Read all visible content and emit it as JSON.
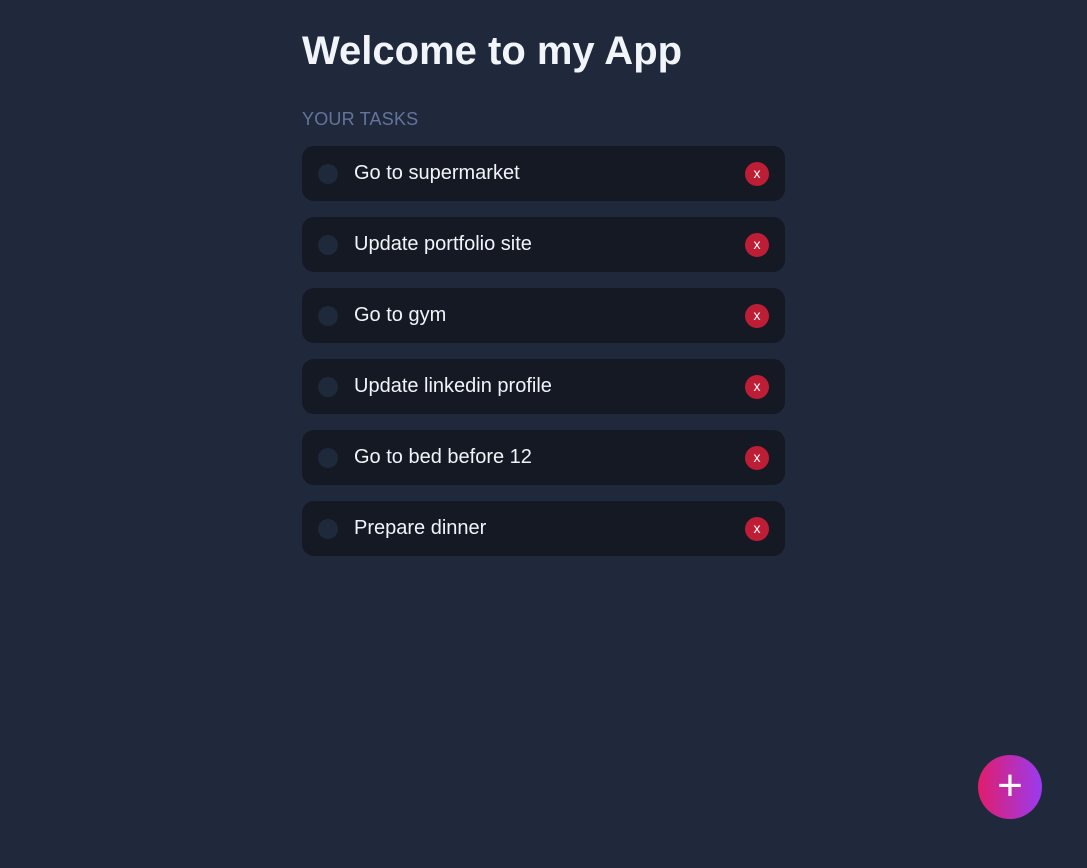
{
  "header": {
    "title": "Welcome to my App"
  },
  "tasks_section": {
    "label": "YOUR TASKS",
    "items": [
      {
        "label": "Go to supermarket",
        "delete_label": "x"
      },
      {
        "label": "Update portfolio site",
        "delete_label": "x"
      },
      {
        "label": "Go to gym",
        "delete_label": "x"
      },
      {
        "label": "Update linkedin profile",
        "delete_label": "x"
      },
      {
        "label": "Go to bed before 12",
        "delete_label": "x"
      },
      {
        "label": "Prepare dinner",
        "delete_label": "x"
      }
    ]
  },
  "fab": {
    "label": "+",
    "icon": "plus-icon"
  },
  "colors": {
    "background": "#1f293b",
    "card": "#141923",
    "delete": "#be1e35",
    "fab_gradient_start": "#e11d6b",
    "fab_gradient_end": "#9a3bf0"
  }
}
